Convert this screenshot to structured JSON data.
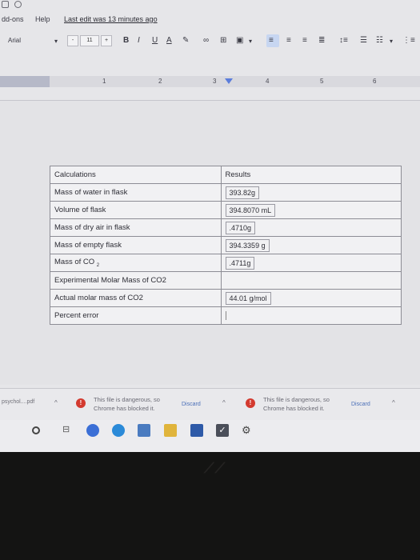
{
  "menu": {
    "addons": "dd-ons",
    "help": "Help",
    "last_edit": "Last edit was 13 minutes ago"
  },
  "toolbar": {
    "font": "Arial",
    "font_size": "11",
    "minus": "-",
    "plus": "+",
    "bold": "B",
    "italic": "I",
    "underline": "U",
    "text_color": "A"
  },
  "ruler": {
    "labels": [
      "1",
      "2",
      "3",
      "4",
      "5",
      "6"
    ]
  },
  "table": {
    "header": {
      "label": "Calculations",
      "value": "Results"
    },
    "rows": [
      {
        "label": "Mass of water in flask",
        "value": "393.82g"
      },
      {
        "label": "Volume of flask",
        "value": "394.8070 mL"
      },
      {
        "label": "Mass of dry air in flask",
        "value": ".4710g"
      },
      {
        "label": "Mass of empty flask",
        "value": "394.3359 g"
      },
      {
        "label": "Mass of CO",
        "label_sub": "2",
        "value": ".4711g"
      },
      {
        "label": "Experimental Molar Mass of CO2",
        "value": ""
      },
      {
        "label": "Actual molar mass of CO2",
        "value": "44.01 g/mol"
      },
      {
        "label": "Percent error",
        "value": ""
      }
    ]
  },
  "downloads": {
    "file_name": "psychol....pdf",
    "items": [
      {
        "message_line1": "This file is dangerous, so",
        "message_line2": "Chrome has blocked it.",
        "discard": "Discard"
      },
      {
        "message_line1": "This file is dangerous, so",
        "message_line2": "Chrome has blocked it.",
        "discard": "Discard"
      }
    ]
  },
  "colors": {
    "screen_bg": "#e6e6e9",
    "bezel": "#141413",
    "warn": "#d33a2f",
    "ruler_marker": "#5b7ddb",
    "active_align": "#c7d6f1"
  }
}
